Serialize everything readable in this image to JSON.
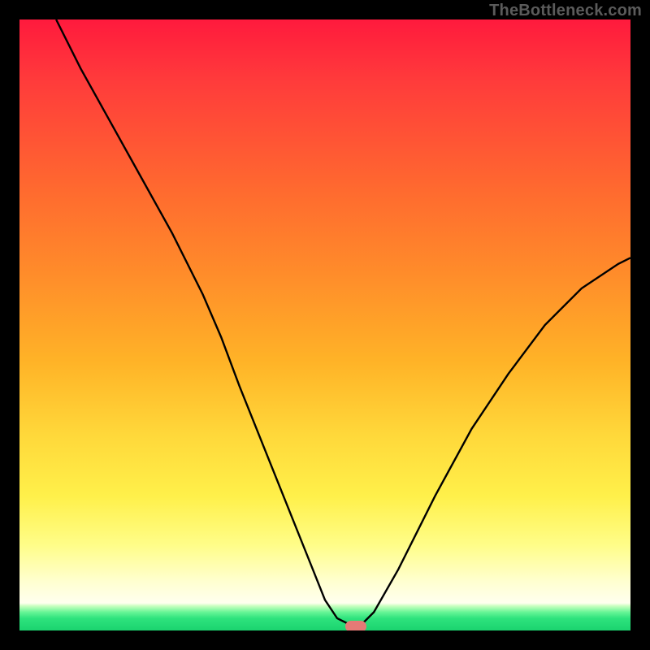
{
  "attribution": "TheBottleneck.com",
  "chart_data": {
    "type": "line",
    "title": "",
    "xlabel": "",
    "ylabel": "",
    "xlim": [
      0,
      100
    ],
    "ylim": [
      0,
      100
    ],
    "grid": false,
    "legend": false,
    "series": [
      {
        "name": "bottleneck-curve",
        "x": [
          6,
          10,
          15,
          20,
          25,
          30,
          33,
          36,
          40,
          44,
          48,
          50,
          52,
          54,
          56,
          58,
          62,
          68,
          74,
          80,
          86,
          92,
          98,
          100
        ],
        "values": [
          100,
          92,
          83,
          74,
          65,
          55,
          48,
          40,
          30,
          20,
          10,
          5,
          2,
          1,
          1,
          3,
          10,
          22,
          33,
          42,
          50,
          56,
          60,
          61
        ]
      }
    ],
    "annotations": [
      {
        "name": "optimal-marker",
        "x": 55,
        "y": 0.5
      }
    ],
    "background_bands_vertical_pct": [
      {
        "color": "#ff1a3d",
        "at": 0
      },
      {
        "color": "#ff6a2f",
        "at": 28
      },
      {
        "color": "#ffb327",
        "at": 56
      },
      {
        "color": "#fff04a",
        "at": 78
      },
      {
        "color": "#ffffd0",
        "at": 92
      },
      {
        "color": "#1bd36f",
        "at": 100
      }
    ]
  },
  "marker": {
    "left_pct": 55,
    "top_pct": 99.3
  }
}
